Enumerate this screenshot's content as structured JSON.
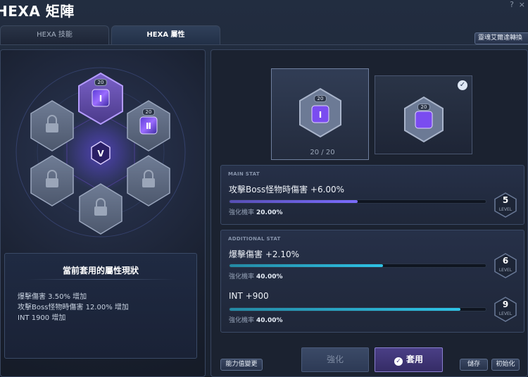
{
  "window": {
    "title": "HEXA 矩陣",
    "help_label": "?",
    "close_label": "×"
  },
  "tabs": [
    {
      "label": "HEXA 技能",
      "active": false
    },
    {
      "label": "HEXA 屬性",
      "active": true
    }
  ],
  "shortcut_button": "靈魂艾爾達轉換",
  "hexa_grid": {
    "slots": [
      {
        "slot": "top",
        "state": "active",
        "level": "20",
        "icon": "hexa-stat-core-icon"
      },
      {
        "slot": "upper-right",
        "state": "unlocked",
        "level": "20",
        "icon": "hexa-stat-core-icon"
      },
      {
        "slot": "upper-left",
        "state": "locked",
        "icon": "lock-icon"
      },
      {
        "slot": "lower-left",
        "state": "locked",
        "icon": "lock-icon"
      },
      {
        "slot": "lower-right",
        "state": "locked",
        "icon": "lock-icon"
      },
      {
        "slot": "bottom",
        "state": "locked",
        "icon": "lock-icon"
      }
    ],
    "center_icon": "hexa-emblem-icon",
    "accent_color": "#8a6bff"
  },
  "status": {
    "title": "當前套用的屬性現狀",
    "lines": [
      "爆擊傷害 3.50% 增加",
      "攻擊Boss怪物時傷害 12.00% 增加",
      "INT 1900 增加"
    ]
  },
  "cards": {
    "left": {
      "level": "20",
      "count": "20 / 20",
      "icon": "hexa-stat-core-icon"
    },
    "right": {
      "level": "20",
      "icon": "hexa-stat-core-icon",
      "checked": true
    }
  },
  "main_stat": {
    "header": "MAIN STAT",
    "name": "攻擊Boss怪物時傷害 +6.00%",
    "progress": 0.5,
    "rate_label": "強化機率",
    "rate_value": "20.00%",
    "level": "5",
    "level_label": "LEVEL",
    "color": "#7b6cff"
  },
  "additional_stat": {
    "header": "ADDITIONAL STAT",
    "items": [
      {
        "name": "爆擊傷害 +2.10%",
        "progress": 0.6,
        "rate_label": "強化機率",
        "rate_value": "40.00%",
        "level": "6",
        "level_label": "LEVEL"
      },
      {
        "name": "INT +900",
        "progress": 0.9,
        "rate_label": "強化機率",
        "rate_value": "40.00%",
        "level": "9",
        "level_label": "LEVEL"
      }
    ],
    "color": "#2ec3e6"
  },
  "buttons": {
    "ability_change": "能力值變更",
    "enhance": "強化",
    "apply": "套用",
    "save": "儲存",
    "reset": "初始化"
  }
}
